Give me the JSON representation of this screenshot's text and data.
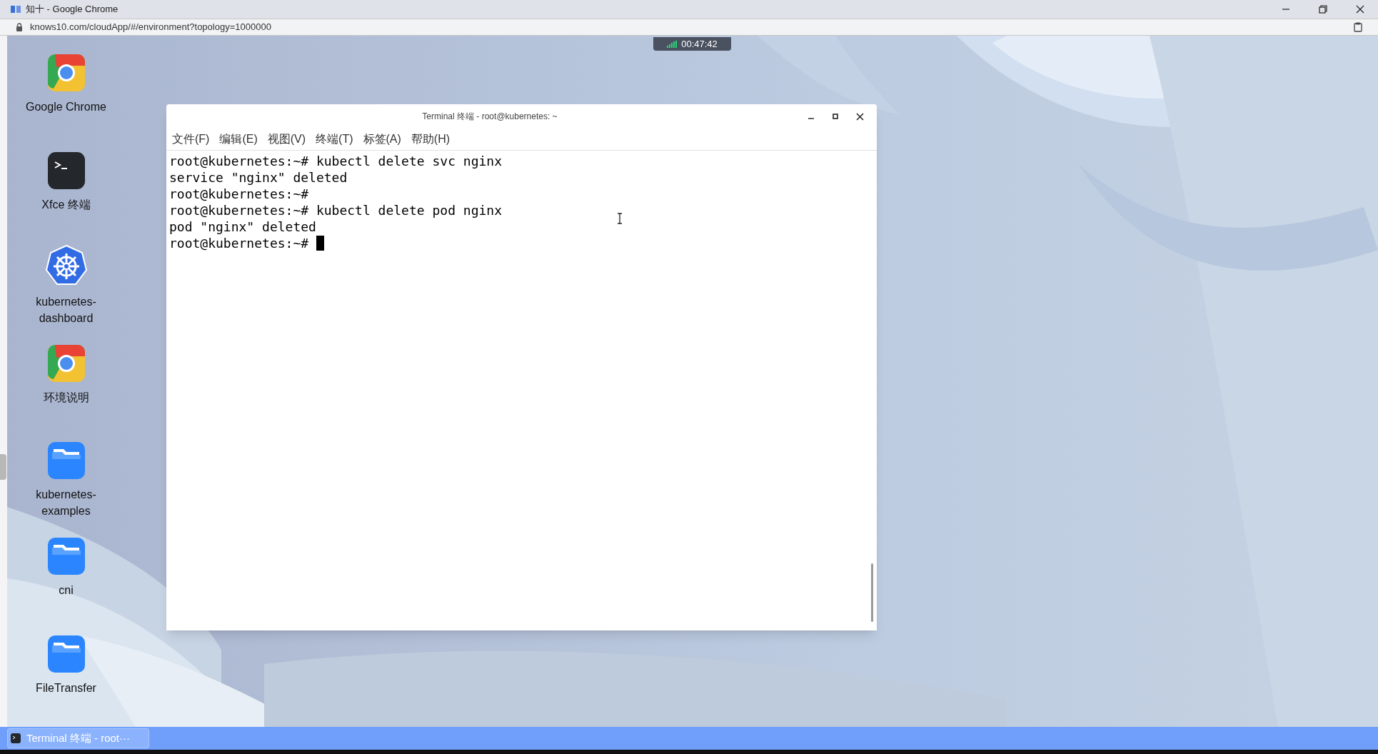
{
  "browser": {
    "title": "知十 - Google Chrome",
    "url": "knows10.com/cloudApp/#/environment?topology=1000000"
  },
  "timer": "00:47:42",
  "desktop_icons": [
    {
      "label": "Google Chrome",
      "kind": "chrome"
    },
    {
      "label": "Xfce 终端",
      "kind": "terminal"
    },
    {
      "label": "kubernetes-dashboard",
      "kind": "kubernetes"
    },
    {
      "label": "环境说明",
      "kind": "chrome"
    },
    {
      "label": "kubernetes-examples",
      "kind": "folder"
    },
    {
      "label": "cni",
      "kind": "folder"
    },
    {
      "label": "FileTransfer",
      "kind": "folder"
    }
  ],
  "terminal": {
    "title": "Terminal 终端 - root@kubernetes: ~",
    "menu": [
      "文件(F)",
      "编辑(E)",
      "视图(V)",
      "终端(T)",
      "标签(A)",
      "帮助(H)"
    ],
    "lines": [
      "root@kubernetes:~# kubectl delete svc nginx",
      "service \"nginx\" deleted",
      "root@kubernetes:~#",
      "root@kubernetes:~# kubectl delete pod nginx",
      "pod \"nginx\" deleted",
      "root@kubernetes:~#"
    ]
  },
  "taskbar": {
    "items": [
      {
        "label": "Terminal 终端 - root···",
        "selected": true
      }
    ]
  }
}
